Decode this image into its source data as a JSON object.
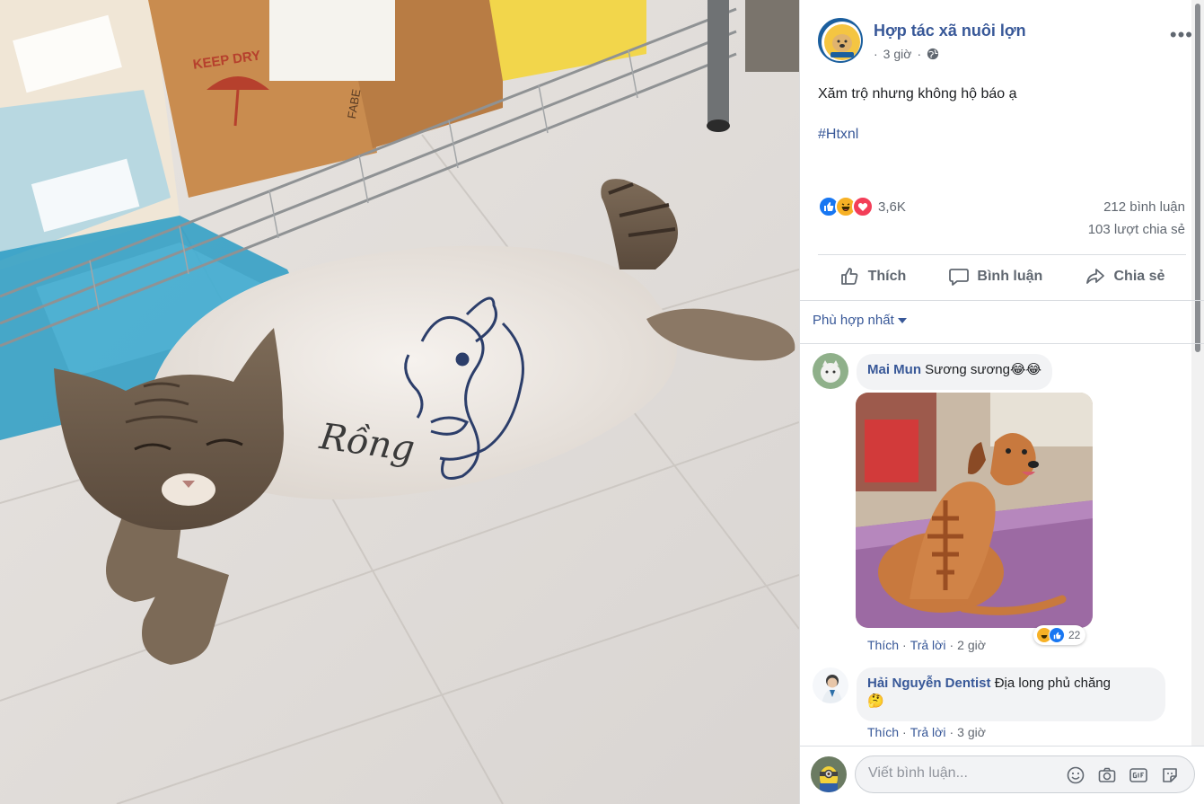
{
  "post": {
    "page_name": "Hợp tác xã nuôi lợn",
    "time": "3 giờ",
    "time_dot": "·",
    "more": "•••",
    "text": "Xăm trộ nhưng không hộ báo ạ",
    "hashtag": "#Htxnl",
    "photo_texts": {
      "box_label": "KEEP DRY",
      "box_label_2": "FABE",
      "tattoo_text": "Rồng"
    }
  },
  "stats": {
    "reactions_count": "3,6K",
    "reaction_icons": [
      "like-icon",
      "haha-icon",
      "love-icon"
    ],
    "comments": "212 bình luận",
    "shares": "103 lượt chia sẻ"
  },
  "actions": {
    "like": "Thích",
    "comment": "Bình luận",
    "share": "Chia sẻ"
  },
  "sort_label": "Phù hợp nhất",
  "comments": [
    {
      "author": "Mai Mun",
      "text": "Sương sương😂😂",
      "reaction_count": "22",
      "like": "Thích",
      "reply": "Trả lời",
      "time": "2 giờ",
      "sep": "·"
    },
    {
      "author": "Hải Nguyễn Dentist",
      "text": "Địa long phủ chăng",
      "emoji": "🤔",
      "like": "Thích",
      "reply": "Trả lời",
      "time": "3 giờ",
      "sep": "·"
    }
  ],
  "composer": {
    "placeholder": "Viết bình luận..."
  },
  "colors": {
    "link": "#385898",
    "meta": "#616770",
    "like_blue": "#1877f2",
    "love_red": "#f33e58",
    "haha_yellow": "#f7b125"
  }
}
